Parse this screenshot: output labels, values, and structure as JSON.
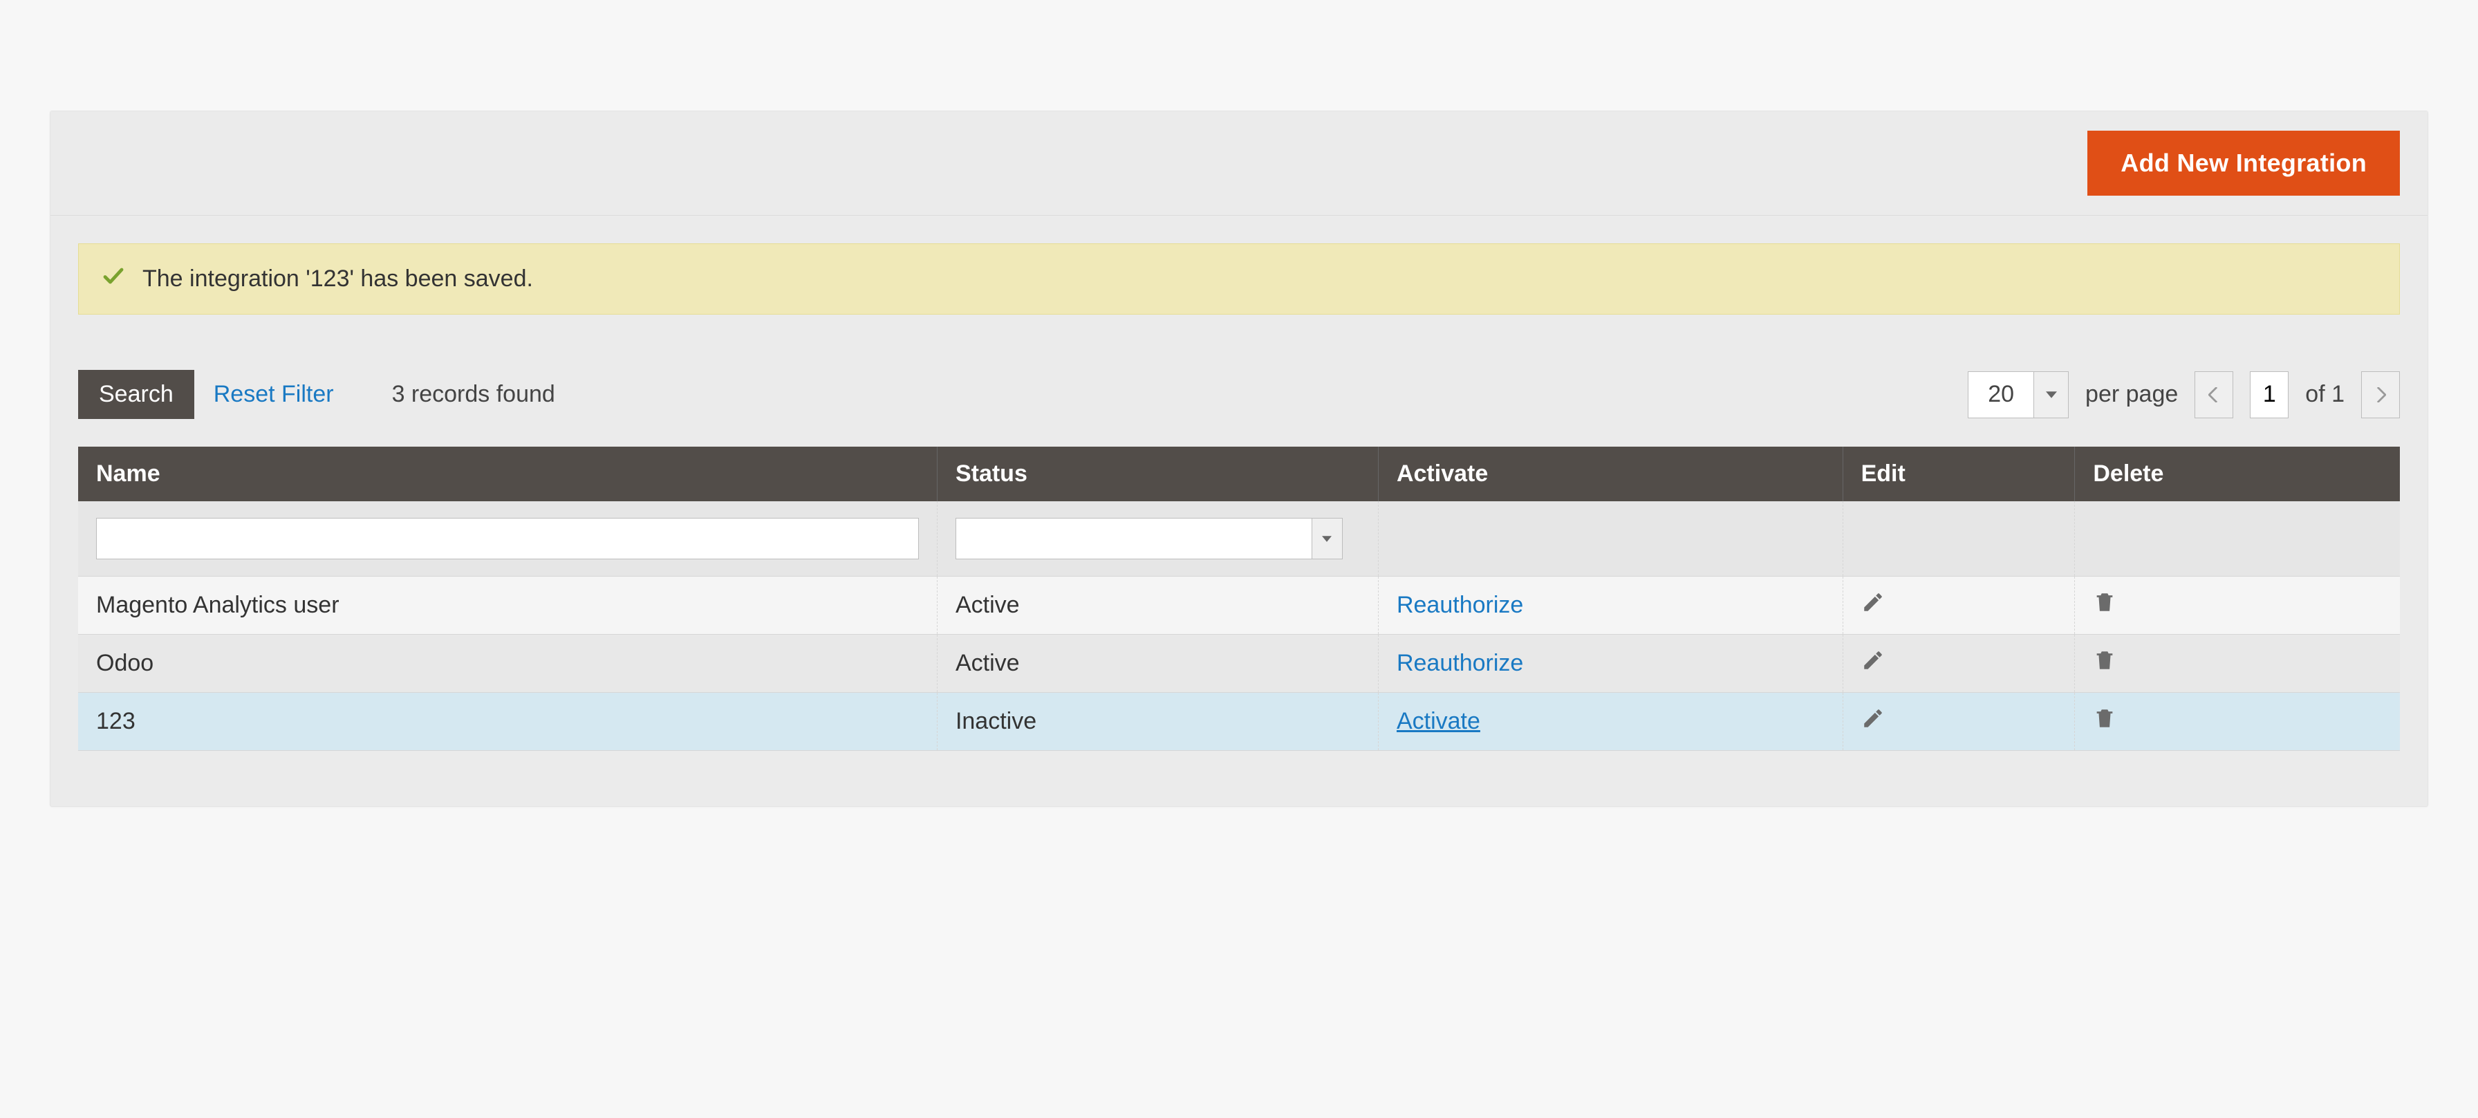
{
  "header": {
    "add_button": "Add New Integration"
  },
  "notice": {
    "message": "The integration '123' has been saved."
  },
  "toolbar": {
    "search": "Search",
    "reset": "Reset Filter",
    "records_found": "3 records found",
    "per_page": "per page",
    "page_size": "20",
    "page_current": "1",
    "page_total": "of 1"
  },
  "columns": {
    "name": "Name",
    "status": "Status",
    "activate": "Activate",
    "edit": "Edit",
    "delete": "Delete"
  },
  "rows": [
    {
      "name": "Magento Analytics user",
      "status": "Active",
      "action": "Reauthorize",
      "underline": false,
      "highlight": false
    },
    {
      "name": "Odoo",
      "status": "Active",
      "action": "Reauthorize",
      "underline": false,
      "highlight": false
    },
    {
      "name": "123",
      "status": "Inactive",
      "action": "Activate",
      "underline": true,
      "highlight": true
    }
  ],
  "colors": {
    "accent": "#e04f16",
    "link": "#1979c3",
    "header_bg": "#524d49",
    "success_bg": "#f0e9b8"
  }
}
